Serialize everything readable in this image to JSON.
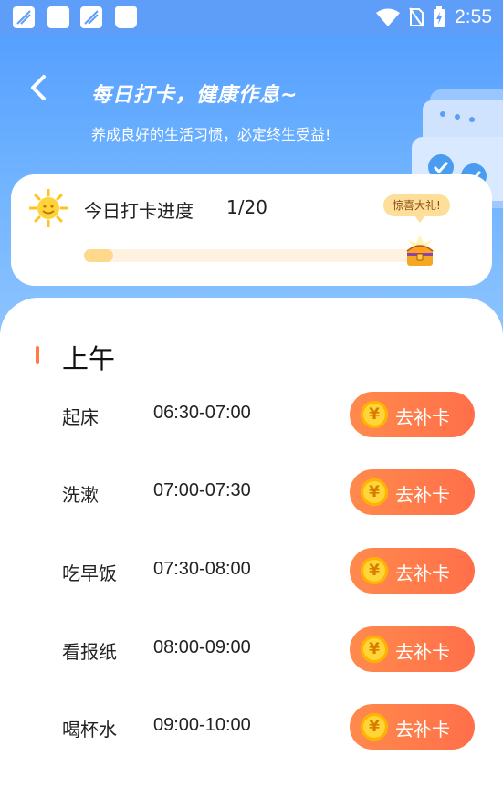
{
  "status_bar": {
    "time": "2:55",
    "icons": [
      "app-icon",
      "app-icon",
      "app-icon",
      "bag-icon",
      "wifi-icon",
      "no-sim-icon",
      "battery-charging-icon"
    ]
  },
  "header": {
    "title": "每日打卡，健康作息~",
    "subtitle": "养成良好的生活习惯，必定终生受益!"
  },
  "progress": {
    "label": "今日打卡进度",
    "count": "1/20",
    "fraction": 0.05,
    "gift_label": "惊喜大礼!"
  },
  "section": {
    "title": "上午",
    "accent": "#ff7a45",
    "rows": [
      {
        "name": "起床",
        "time": "06:30-07:00",
        "button": "去补卡",
        "coin": "¥"
      },
      {
        "name": "洗漱",
        "time": "07:00-07:30",
        "button": "去补卡",
        "coin": "¥"
      },
      {
        "name": "吃早饭",
        "time": "07:30-08:00",
        "button": "去补卡",
        "coin": "¥"
      },
      {
        "name": "看报纸",
        "time": "08:00-09:00",
        "button": "去补卡",
        "coin": "¥"
      },
      {
        "name": "喝杯水",
        "time": "09:00-10:00",
        "button": "去补卡",
        "coin": "¥"
      }
    ]
  },
  "colors": {
    "hero_blue": "#56a0ff",
    "button_orange": "#ff7a4a",
    "progress_fill": "#fdd88d"
  }
}
